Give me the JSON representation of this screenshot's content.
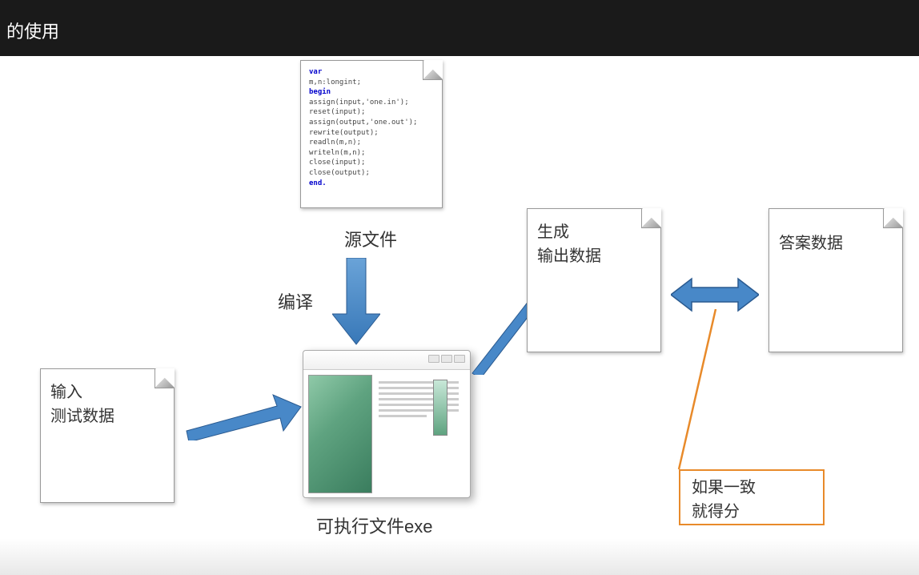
{
  "header": {
    "title": "的使用"
  },
  "diagram": {
    "source_code": {
      "lines": [
        {
          "t": "var",
          "cls": "kw"
        },
        {
          "t": "m,n:longint;",
          "cls": ""
        },
        {
          "t": "begin",
          "cls": "kw"
        },
        {
          "t": "  assign(input,'one.in');",
          "cls": ""
        },
        {
          "t": "  reset(input);",
          "cls": ""
        },
        {
          "t": "  assign(output,'one.out');",
          "cls": ""
        },
        {
          "t": "  rewrite(output);",
          "cls": ""
        },
        {
          "t": "  readln(m,n);",
          "cls": ""
        },
        {
          "t": "  writeln(m,n);",
          "cls": ""
        },
        {
          "t": "  close(input);",
          "cls": ""
        },
        {
          "t": "  close(output);",
          "cls": ""
        },
        {
          "t": "end.",
          "cls": "kw"
        }
      ]
    },
    "labels": {
      "source_file": "源文件",
      "compile": "编译",
      "executable": "可执行文件exe",
      "input_data_l1": "输入",
      "input_data_l2": "测试数据",
      "output_l1": "生成",
      "output_l2": "输出数据",
      "answer": "答案数据",
      "callout_l1": "如果一致",
      "callout_l2": "就得分"
    }
  }
}
